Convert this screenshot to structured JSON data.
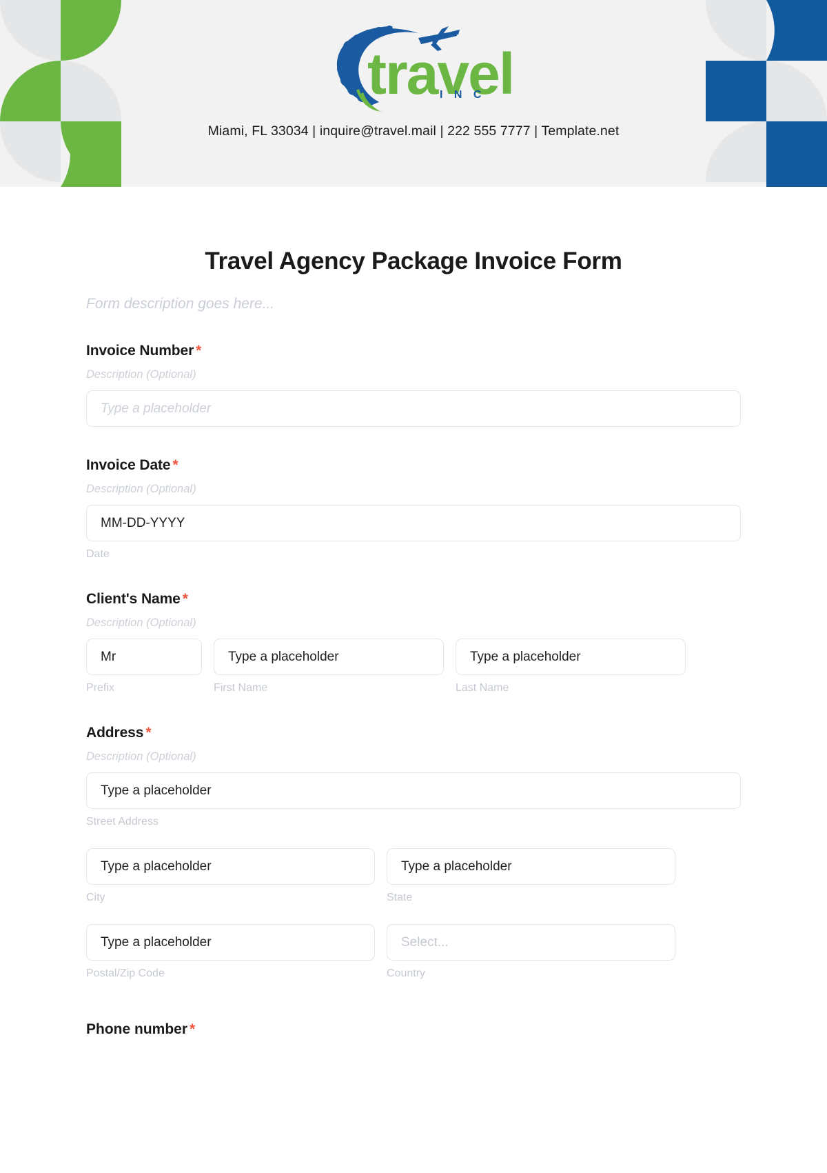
{
  "header": {
    "logo": {
      "brand_text": "travel",
      "sub_text": "I N C",
      "airplane_icon": "airplane-icon",
      "swoosh_icon": "swoosh-icon",
      "brand_green": "#6cb744",
      "brand_blue": "#1a5aa0"
    },
    "contact_line": "Miami, FL 33034 | inquire@travel.mail | 222 555 7777 | Template.net",
    "decoration": {
      "left_color": "#6cb744",
      "right_color": "#125a9e",
      "neutral_color": "#e4e6e8",
      "background": "#f2f2f2"
    }
  },
  "form": {
    "title": "Travel Agency Package Invoice Form",
    "description": "Form description goes here...",
    "required_marker": "*",
    "description_placeholder": "Description (Optional)",
    "fields": [
      {
        "label": "Invoice Number",
        "required": true,
        "description": "Description (Optional)",
        "inputs": [
          {
            "placeholder": "Type a placeholder",
            "value": "",
            "sublabel": ""
          }
        ]
      },
      {
        "label": "Invoice Date",
        "required": true,
        "description": "Description (Optional)",
        "inputs": [
          {
            "placeholder": "",
            "value": "MM-DD-YYYY",
            "sublabel": "Date"
          }
        ]
      },
      {
        "label": "Client's Name",
        "required": true,
        "description": "Description (Optional)",
        "inputs": [
          {
            "placeholder": "",
            "value": "Mr",
            "sublabel": "Prefix"
          },
          {
            "placeholder": "Type a placeholder",
            "value": "",
            "sublabel": "First Name"
          },
          {
            "placeholder": "Type a placeholder",
            "value": "",
            "sublabel": "Last Name"
          }
        ]
      },
      {
        "label": "Address",
        "required": true,
        "description": "Description (Optional)",
        "inputs": [
          {
            "placeholder": "Type a placeholder",
            "value": "",
            "sublabel": "Street Address"
          },
          {
            "placeholder": "Type a placeholder",
            "value": "",
            "sublabel": "City"
          },
          {
            "placeholder": "Type a placeholder",
            "value": "",
            "sublabel": "State"
          },
          {
            "placeholder": "Type a placeholder",
            "value": "",
            "sublabel": "Postal/Zip Code"
          },
          {
            "placeholder": "Select...",
            "value": "",
            "sublabel": "Country"
          }
        ]
      },
      {
        "label": "Phone number",
        "required": true,
        "description": "",
        "inputs": []
      }
    ]
  }
}
